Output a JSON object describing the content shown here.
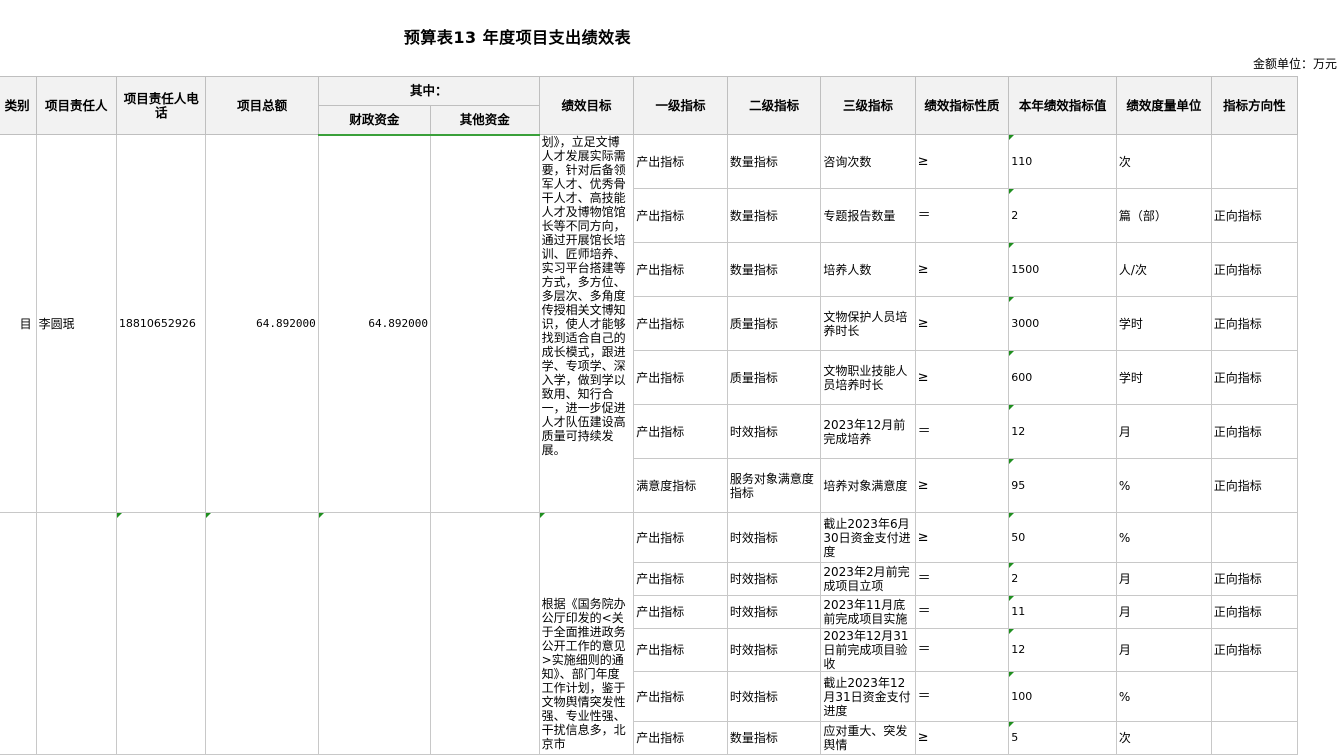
{
  "title": "预算表13 年度项目支出绩效表",
  "unit_label": "金额单位：万元",
  "headers": {
    "category": "类别",
    "owner": "项目责任人",
    "phone": "项目责任人电话",
    "total": "项目总额",
    "of_which": "其中：",
    "fiscal": "财政资金",
    "other": "其他资金",
    "goal": "绩效目标",
    "level1": "一级指标",
    "level2": "二级指标",
    "level3": "三级指标",
    "nature": "绩效指标性质",
    "value": "本年绩效指标值",
    "measure_unit": "绩效度量单位",
    "direction": "指标方向性"
  },
  "project1": {
    "category_fragment": "目",
    "owner": "李圆珉",
    "phone": "18810652926",
    "total": "64.892000",
    "fiscal": "64.892000",
    "other": "",
    "goal": "划》，立足文博人才发展实际需要，针对后备领军人才、优秀骨干人才、高技能人才及博物馆馆长等不同方向，通过开展馆长培训、匠师培养、实习平台搭建等方式，多方位、多层次、多角度传授相关文博知识，使人才能够找到适合自己的成长模式，跟进学、专项学、深入学，做到学以致用、知行合一，进一步促进人才队伍建设高质量可持续发展。",
    "rows": [
      {
        "l1": "产出指标",
        "l2": "数量指标",
        "l3": "咨询次数",
        "nature": "≥",
        "value": "110",
        "unit": "次",
        "dir": ""
      },
      {
        "l1": "产出指标",
        "l2": "数量指标",
        "l3": "专题报告数量",
        "nature": "＝",
        "value": "2",
        "unit": "篇（部）",
        "dir": "正向指标"
      },
      {
        "l1": "产出指标",
        "l2": "数量指标",
        "l3": "培养人数",
        "nature": "≥",
        "value": "1500",
        "unit": "人/次",
        "dir": "正向指标"
      },
      {
        "l1": "产出指标",
        "l2": "质量指标",
        "l3": "文物保护人员培养时长",
        "nature": "≥",
        "value": "3000",
        "unit": "学时",
        "dir": "正向指标"
      },
      {
        "l1": "产出指标",
        "l2": "质量指标",
        "l3": "文物职业技能人员培养时长",
        "nature": "≥",
        "value": "600",
        "unit": "学时",
        "dir": "正向指标"
      },
      {
        "l1": "产出指标",
        "l2": "时效指标",
        "l3": "2023年12月前完成培养",
        "nature": "＝",
        "value": "12",
        "unit": "月",
        "dir": "正向指标"
      },
      {
        "l1": "满意度指标",
        "l2": "服务对象满意度指标",
        "l3": "培养对象满意度",
        "nature": "≥",
        "value": "95",
        "unit": "%",
        "dir": "正向指标"
      }
    ]
  },
  "project2": {
    "goal": "根据《国务院办公厅印发的<关于全面推进政务公开工作的意见>实施细则的通知》、部门年度工作计划，鉴于文物舆情突发性强、专业性强、干扰信息多，北京市",
    "rows": [
      {
        "l1": "产出指标",
        "l2": "时效指标",
        "l3": "截止2023年6月30日资金支付进度",
        "nature": "≥",
        "value": "50",
        "unit": "%",
        "dir": ""
      },
      {
        "l1": "产出指标",
        "l2": "时效指标",
        "l3": "2023年2月前完成项目立项",
        "nature": "＝",
        "value": "2",
        "unit": "月",
        "dir": "正向指标"
      },
      {
        "l1": "产出指标",
        "l2": "时效指标",
        "l3": "2023年11月底前完成项目实施",
        "nature": "＝",
        "value": "11",
        "unit": "月",
        "dir": "正向指标"
      },
      {
        "l1": "产出指标",
        "l2": "时效指标",
        "l3": "2023年12月31日前完成项目验收",
        "nature": "＝",
        "value": "12",
        "unit": "月",
        "dir": "正向指标"
      },
      {
        "l1": "产出指标",
        "l2": "时效指标",
        "l3": "截止2023年12月31日资金支付进度",
        "nature": "＝",
        "value": "100",
        "unit": "%",
        "dir": ""
      },
      {
        "l1": "产出指标",
        "l2": "数量指标",
        "l3": "应对重大、突发舆情",
        "nature": "≥",
        "value": "5",
        "unit": "次",
        "dir": ""
      }
    ]
  }
}
